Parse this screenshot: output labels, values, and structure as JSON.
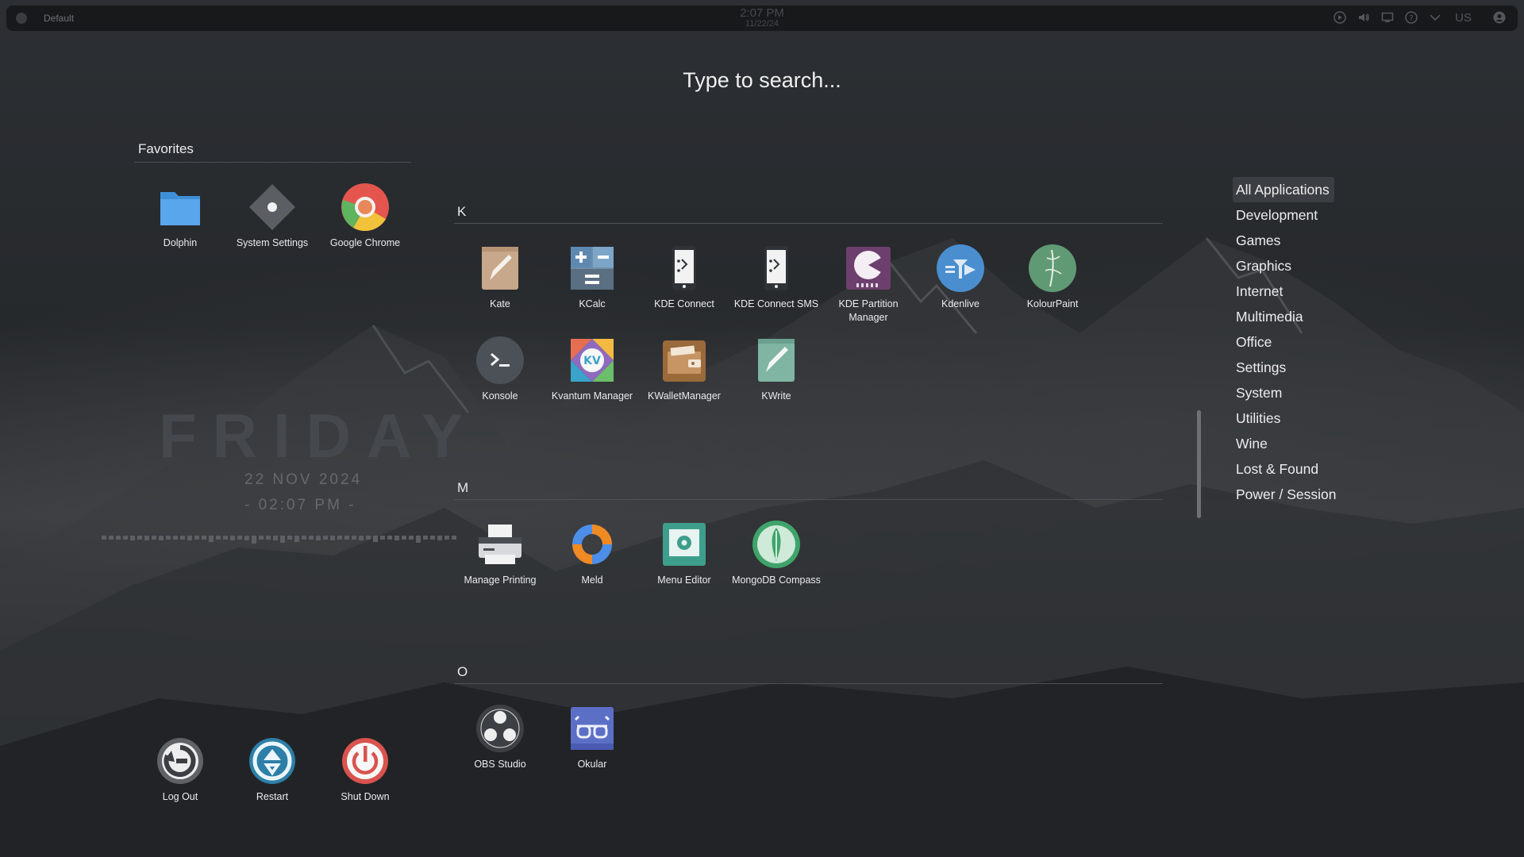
{
  "topbar": {
    "activity": "Default",
    "clock_time": "2:07 PM",
    "clock_date": "11/22/24",
    "keyboard_layout": "US"
  },
  "search": {
    "placeholder": "Type to search..."
  },
  "favorites": {
    "title": "Favorites",
    "apps": [
      {
        "label": "Dolphin",
        "icon": "folder-icon"
      },
      {
        "label": "System Settings",
        "icon": "settings-icon"
      },
      {
        "label": "Google Chrome",
        "icon": "chrome-icon"
      }
    ]
  },
  "session": [
    {
      "label": "Log Out",
      "icon": "logout-icon"
    },
    {
      "label": "Restart",
      "icon": "restart-icon"
    },
    {
      "label": "Shut Down",
      "icon": "power-icon"
    }
  ],
  "widget": {
    "day": "FRIDAY",
    "date": "22 NOV 2024",
    "time": "- 02:07 PM -"
  },
  "sections": [
    {
      "letter": "K",
      "apps": [
        {
          "label": "Kate",
          "icon": "kate-icon"
        },
        {
          "label": "KCalc",
          "icon": "calculator-icon"
        },
        {
          "label": "KDE Connect",
          "icon": "kdeconnect-icon"
        },
        {
          "label": "KDE Connect SMS",
          "icon": "kdeconnect-sms-icon"
        },
        {
          "label": "KDE Partition Manager",
          "icon": "partition-manager-icon"
        },
        {
          "label": "Kdenlive",
          "icon": "kdenlive-icon"
        },
        {
          "label": "KolourPaint",
          "icon": "kolourpaint-icon"
        },
        {
          "label": "Konsole",
          "icon": "terminal-icon"
        },
        {
          "label": "Kvantum Manager",
          "icon": "kvantum-icon"
        },
        {
          "label": "KWalletManager",
          "icon": "wallet-icon"
        },
        {
          "label": "KWrite",
          "icon": "kwrite-icon"
        }
      ]
    },
    {
      "letter": "M",
      "apps": [
        {
          "label": "Manage Printing",
          "icon": "printer-icon"
        },
        {
          "label": "Meld",
          "icon": "meld-icon"
        },
        {
          "label": "Menu Editor",
          "icon": "menu-editor-icon"
        },
        {
          "label": "MongoDB Compass",
          "icon": "mongodb-icon"
        }
      ]
    },
    {
      "letter": "O",
      "apps": [
        {
          "label": "OBS Studio",
          "icon": "obs-icon"
        },
        {
          "label": "Okular",
          "icon": "okular-icon"
        }
      ]
    }
  ],
  "categories": [
    "All Applications",
    "Development",
    "Games",
    "Graphics",
    "Internet",
    "Multimedia",
    "Office",
    "Settings",
    "System",
    "Utilities",
    "Wine",
    "Lost & Found",
    "Power / Session"
  ],
  "selected_category": "All Applications"
}
